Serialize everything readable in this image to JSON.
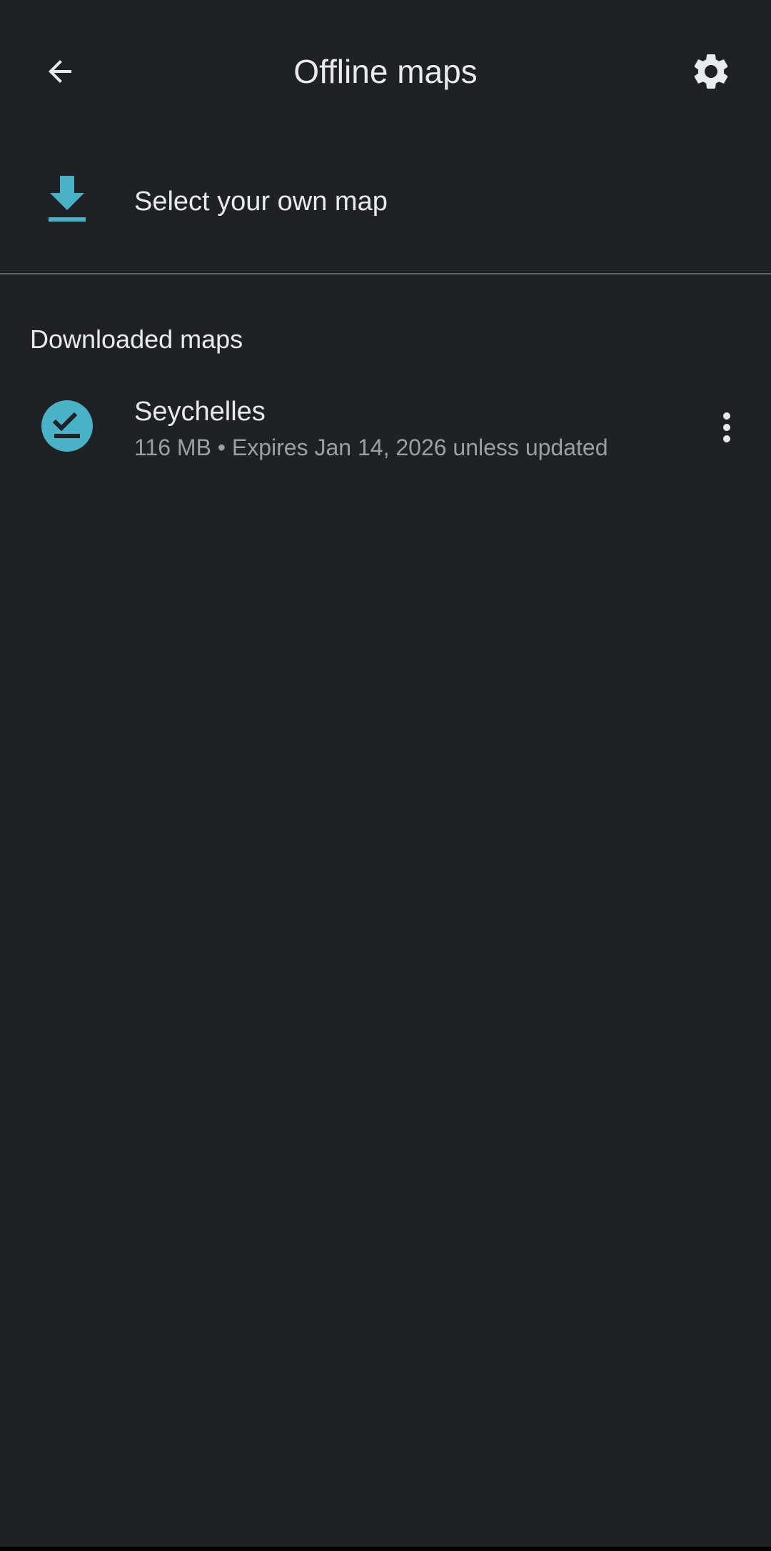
{
  "header": {
    "title": "Offline maps",
    "back_icon": "arrow-back-icon",
    "settings_icon": "gear-icon"
  },
  "select_map": {
    "label": "Select your own map",
    "icon": "download-icon"
  },
  "downloaded": {
    "section_title": "Downloaded maps",
    "items": [
      {
        "name": "Seychelles",
        "size": "116 MB",
        "separator": "•",
        "expiry": "Expires Jan 14, 2026 unless updated",
        "status_icon": "download-done-icon",
        "menu_icon": "more-vert-icon"
      }
    ]
  },
  "colors": {
    "background": "#202124",
    "accent": "#4ab2c6",
    "text_primary": "#e8eaed",
    "text_secondary": "#9aa0a6",
    "divider": "#5f6368"
  }
}
